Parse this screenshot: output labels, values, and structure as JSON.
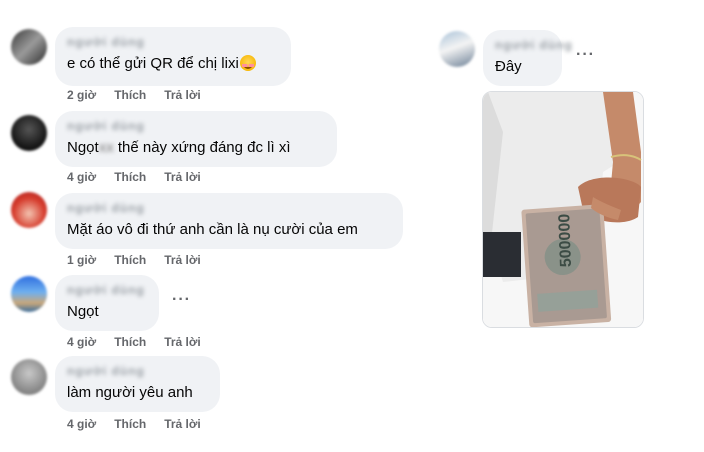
{
  "comments": [
    {
      "author": "người dùng",
      "text": "e có thể gửi QR để chị lixi",
      "emoji": "smiling-face-icon",
      "time": "2 giờ",
      "like": "Thích",
      "reply": "Trả lời"
    },
    {
      "author": "người dùng",
      "text_before": "Ngọt",
      "text_hidden": "xx",
      "text_after": " thế này xứng đáng đc lì xì",
      "time": "4 giờ",
      "like": "Thích",
      "reply": "Trả lời"
    },
    {
      "author": "người dùng",
      "text": "Mặt áo vô đi thứ anh cần là nụ cười của em",
      "time": "1 giờ",
      "like": "Thích",
      "reply": "Trả lời"
    },
    {
      "author": "người dùng",
      "text": "Ngọt",
      "time": "4 giờ",
      "like": "Thích",
      "reply": "Trả lời"
    },
    {
      "author": "người dùng",
      "text": "làm người yêu anh",
      "time": "4 giờ",
      "like": "Thích",
      "reply": "Trả lời"
    }
  ],
  "right_comment": {
    "author": "người dùng",
    "text": "Đây",
    "banknote_value": "500000"
  },
  "more_label": "···",
  "colors": {
    "bubble": "#f0f2f5",
    "meta": "#65676b",
    "text": "#050505"
  }
}
